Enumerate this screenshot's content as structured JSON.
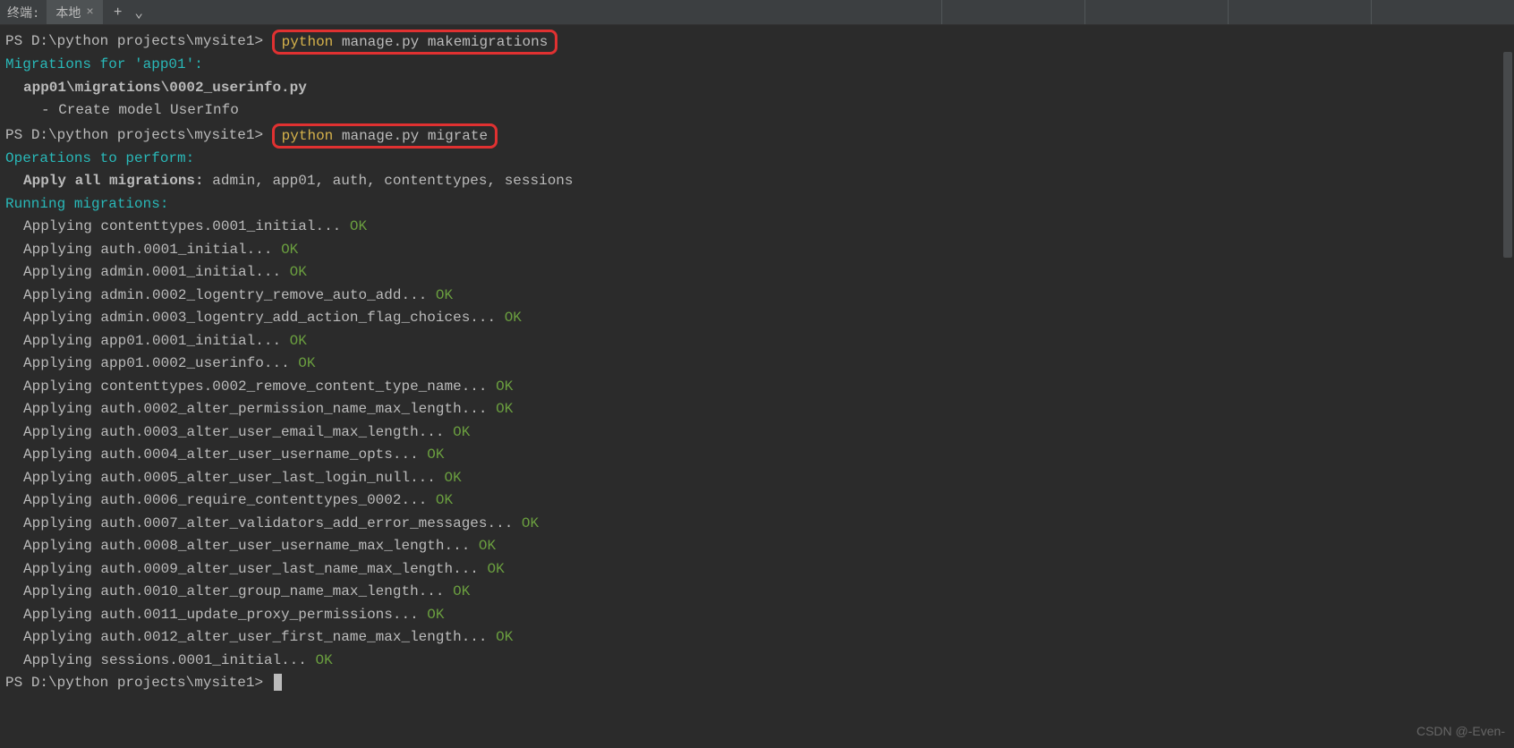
{
  "tabbar": {
    "label": "终端:",
    "tab_name": "本地",
    "close": "×",
    "plus": "+",
    "chevron": "⌄"
  },
  "t": {
    "ps": "PS ",
    "path": "D:\\python projects\\mysite1",
    "gt": "> ",
    "cmd1_py": "python",
    "cmd1_rest": " manage.py makemigrations",
    "mig_for": "Migrations for 'app01':",
    "mig_file": "app01\\migrations\\0002_userinfo.py",
    "mig_create": "- Create model UserInfo",
    "cmd2_py": "python",
    "cmd2_rest": " manage.py migrate",
    "ops": "Operations to perform:",
    "apply_all_lbl": "Apply all migrations:",
    "apply_all_list": " admin, app01, auth, contenttypes, sessions",
    "running": "Running migrations:",
    "applying": "Applying ",
    "dots": "... ",
    "ok": "OK",
    "m": [
      "contenttypes.0001_initial",
      "auth.0001_initial",
      "admin.0001_initial",
      "admin.0002_logentry_remove_auto_add",
      "admin.0003_logentry_add_action_flag_choices",
      "app01.0001_initial",
      "app01.0002_userinfo",
      "contenttypes.0002_remove_content_type_name",
      "auth.0002_alter_permission_name_max_length",
      "auth.0003_alter_user_email_max_length",
      "auth.0004_alter_user_username_opts",
      "auth.0005_alter_user_last_login_null",
      "auth.0006_require_contenttypes_0002",
      "auth.0007_alter_validators_add_error_messages",
      "auth.0008_alter_user_username_max_length",
      "auth.0009_alter_user_last_name_max_length",
      "auth.0010_alter_group_name_max_length",
      "auth.0011_update_proxy_permissions",
      "auth.0012_alter_user_first_name_max_length",
      "sessions.0001_initial"
    ]
  },
  "watermark": "CSDN @-Even-"
}
